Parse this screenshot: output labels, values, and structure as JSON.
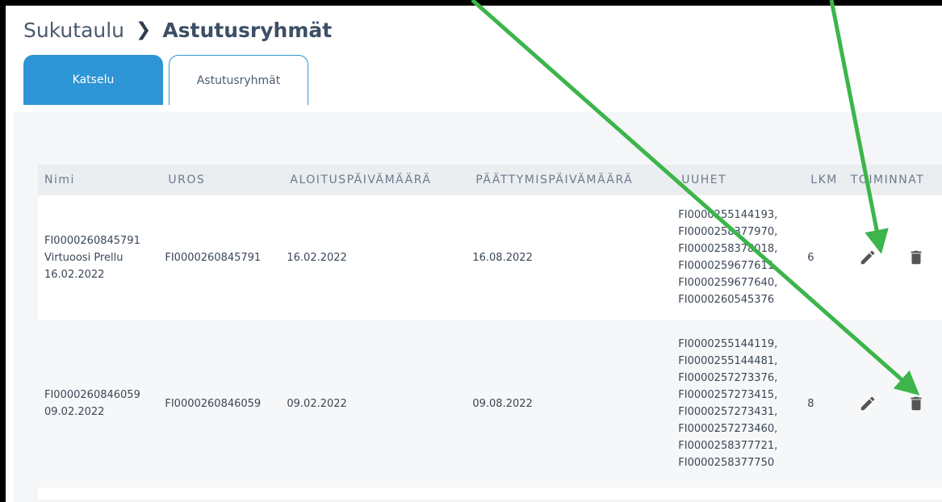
{
  "breadcrumb": {
    "root": "Sukutaulu",
    "separator": ">",
    "current": "Astutusryhmät"
  },
  "tabs": [
    {
      "label": "Katselu"
    },
    {
      "label": "Astutusryhmät"
    }
  ],
  "table": {
    "headers": [
      "Nimi",
      "UROS",
      "ALOITUSPÄIVÄMÄÄRÄ",
      "PÄÄTTYMISPÄIVÄMÄÄRÄ",
      "UUHET",
      "LKM",
      "TOIMINNAT"
    ],
    "rows": [
      {
        "nimi": [
          "FI0000260845791",
          "Virtuoosi Prellu",
          "16.02.2022"
        ],
        "uros": "FI0000260845791",
        "aloitus": "16.02.2022",
        "paattymis": "16.08.2022",
        "uuhet": [
          "FI0000255144193,",
          "FI0000258377970,",
          "FI0000258378018,",
          "FI0000259677611,",
          "FI0000259677640,",
          "FI0000260545376"
        ],
        "lkm": "6"
      },
      {
        "nimi": [
          "FI0000260846059",
          "09.02.2022"
        ],
        "uros": "FI0000260846059",
        "aloitus": "09.02.2022",
        "paattymis": "09.08.2022",
        "uuhet": [
          "FI0000255144119,",
          "FI0000255144481,",
          "FI0000257273376,",
          "FI0000257273415,",
          "FI0000257273431,",
          "FI0000257273460,",
          "FI0000258377721,",
          "FI0000258377750"
        ],
        "lkm": "8"
      }
    ]
  },
  "icons": {
    "edit": "pencil-icon",
    "delete": "trash-icon"
  },
  "colors": {
    "accent": "#2e95d6",
    "arrow": "#3cb54a",
    "icon": "#555555"
  }
}
